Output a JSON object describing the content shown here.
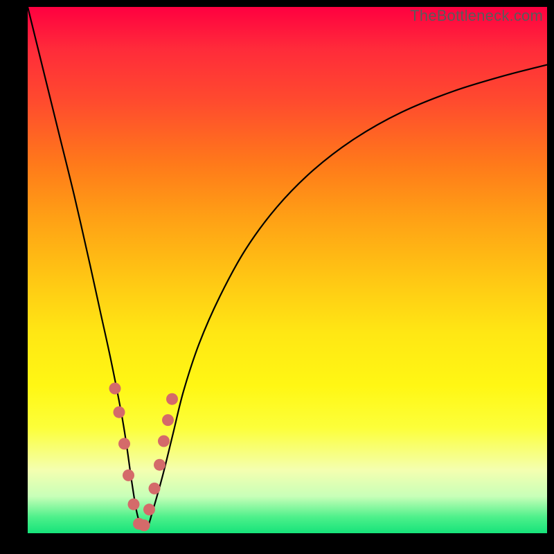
{
  "watermark": "TheBottleneck.com",
  "chart_data": {
    "type": "line",
    "title": "",
    "xlabel": "",
    "ylabel": "",
    "xlim": [
      0,
      100
    ],
    "ylim": [
      0,
      100
    ],
    "series": [
      {
        "name": "bottleneck-curve",
        "x": [
          0,
          3,
          6,
          9,
          12,
          14,
          16,
          18,
          19,
          20,
          21,
          22,
          23,
          24,
          26,
          28,
          30,
          33,
          37,
          42,
          48,
          55,
          63,
          72,
          82,
          92,
          100
        ],
        "values": [
          100,
          88,
          76,
          64,
          51,
          42,
          33,
          23,
          17,
          10,
          4,
          1,
          1,
          4,
          11,
          19,
          27,
          36,
          45,
          54,
          62,
          69,
          75,
          80,
          84,
          87,
          89
        ]
      }
    ],
    "markers": {
      "name": "highlight-dots",
      "color": "#d46a6a",
      "x": [
        16.8,
        17.6,
        18.6,
        19.4,
        20.4,
        21.4,
        22.4,
        23.4,
        24.4,
        25.4,
        26.2,
        27.0,
        27.8
      ],
      "values": [
        27.5,
        23.0,
        17.0,
        11.0,
        5.5,
        1.8,
        1.5,
        4.5,
        8.5,
        13.0,
        17.5,
        21.5,
        25.5
      ]
    },
    "background": "rainbow-vertical-gradient"
  }
}
